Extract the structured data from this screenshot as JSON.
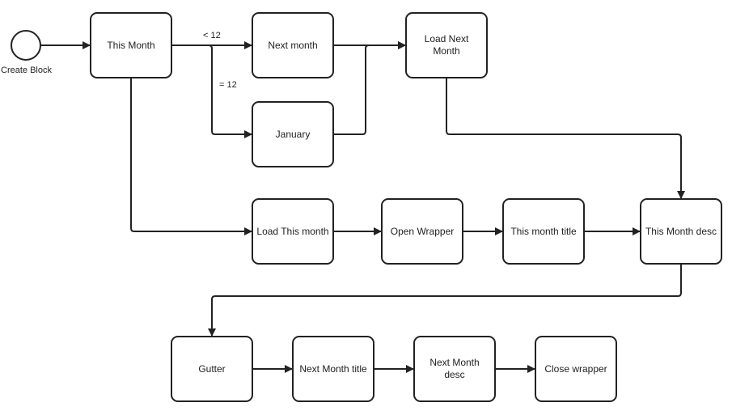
{
  "start": {
    "label": "Create Block"
  },
  "nodes": {
    "this_month": "This Month",
    "next_month": "Next month",
    "load_next_month": "Load Next Month",
    "january": "January",
    "load_this_month": "Load This month",
    "open_wrapper": "Open Wrapper",
    "this_month_title": "This month title",
    "this_month_desc": "This Month desc",
    "gutter": "Gutter",
    "next_month_title": "Next Month title",
    "next_month_desc": "Next Month desc",
    "close_wrapper": "Close wrapper"
  },
  "edge_labels": {
    "less_than_12": "< 12",
    "equals_12": "= 12"
  },
  "colors": {
    "stroke": "#222222",
    "background": "#ffffff"
  }
}
